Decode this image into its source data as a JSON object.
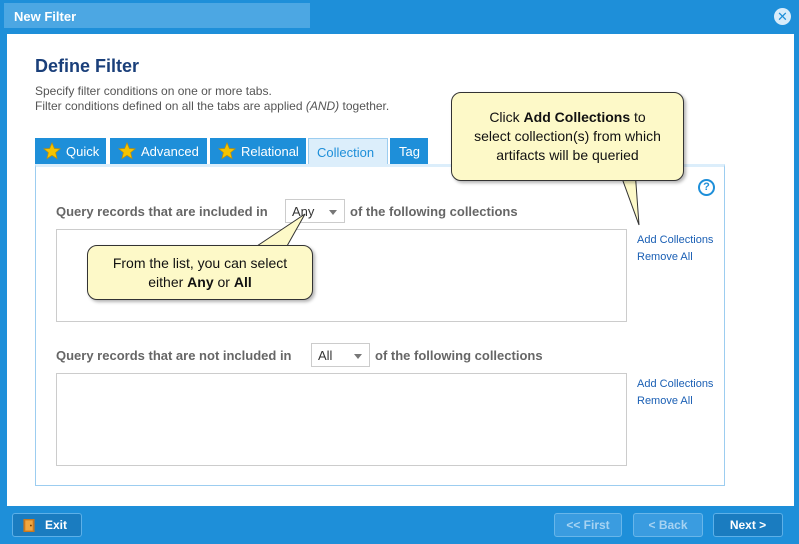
{
  "window": {
    "title": "New Filter",
    "close_glyph": "✕"
  },
  "header": {
    "title": "Define Filter",
    "desc_line1": "Specify filter conditions on one or more tabs.",
    "desc_line2_pre": "Filter conditions defined on all the tabs are applied ",
    "desc_line2_em": "(AND)",
    "desc_line2_post": " together."
  },
  "tabs": [
    {
      "label": "Quick",
      "icon": "star-icon",
      "active": false
    },
    {
      "label": "Advanced",
      "icon": "star-icon",
      "active": false
    },
    {
      "label": "Relational",
      "icon": "star-icon",
      "active": false
    },
    {
      "label": "Collection",
      "active": true
    },
    {
      "label": "Tag",
      "active": false
    }
  ],
  "help_glyph": "?",
  "included": {
    "label_pre": "Query records that are included in",
    "selected": "Any",
    "label_post": "of the following collections",
    "add_link": "Add Collections",
    "remove_link": "Remove All"
  },
  "excluded": {
    "label_pre": "Query records that are not included in",
    "selected": "All",
    "label_post": "of the following collections",
    "add_link": "Add Collections",
    "remove_link": "Remove All"
  },
  "callouts": {
    "add": {
      "pre": "Click ",
      "bold": "Add Collections",
      "post1": " to",
      "line2": "select collection(s) from which",
      "line3": "artifacts will be queried"
    },
    "list": {
      "line1": "From the list, you can select",
      "pre2": "either ",
      "bold1": "Any",
      "mid": " or ",
      "bold2": "All"
    }
  },
  "footer": {
    "exit": "Exit",
    "first": "<< First",
    "back": "< Back",
    "next": "Next >"
  },
  "colors": {
    "brand_blue": "#1e8fd9",
    "heading": "#1a3f7a",
    "callout_bg": "#fdf9c8",
    "star": "#f5c400"
  }
}
